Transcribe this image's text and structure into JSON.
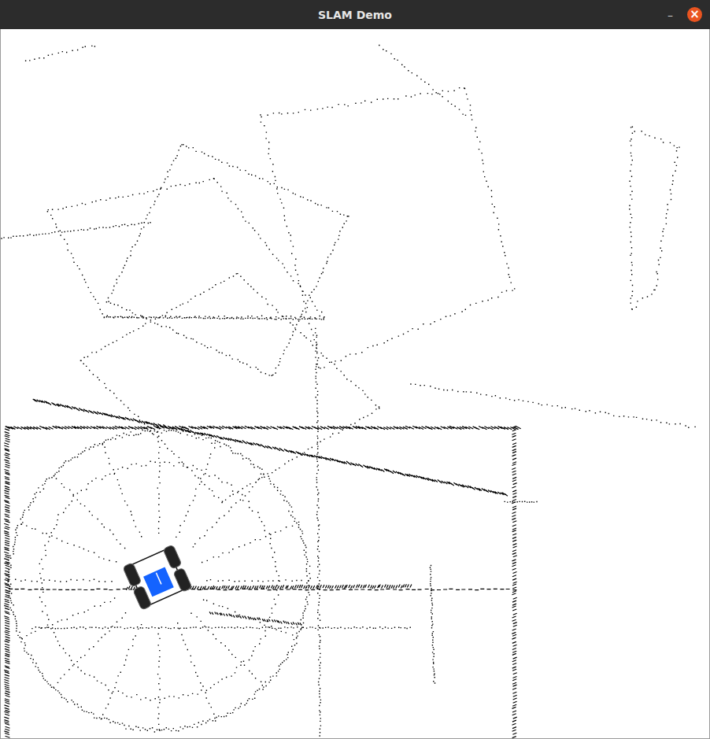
{
  "window": {
    "title": "SLAM Demo"
  },
  "controls": {
    "minimize": "–",
    "close": "×"
  }
}
